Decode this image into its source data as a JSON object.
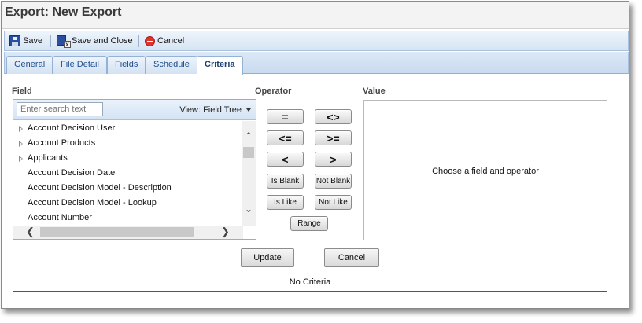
{
  "window": {
    "title": "Export: New Export"
  },
  "toolbar": {
    "save": "Save",
    "save_close": "Save and Close",
    "cancel": "Cancel"
  },
  "tabs": [
    "General",
    "File Detail",
    "Fields",
    "Schedule",
    "Criteria"
  ],
  "active_tab": "Criteria",
  "labels": {
    "field": "Field",
    "operator": "Operator",
    "value": "Value"
  },
  "search": {
    "placeholder": "Enter search text",
    "value": ""
  },
  "view_selector": {
    "label": "View: Field Tree"
  },
  "field_tree": [
    {
      "label": "Account Decision User",
      "expandable": true
    },
    {
      "label": "Account Products",
      "expandable": true
    },
    {
      "label": "Applicants",
      "expandable": true
    },
    {
      "label": "Account Decision Date",
      "expandable": false
    },
    {
      "label": "Account Decision Model - Description",
      "expandable": false
    },
    {
      "label": "Account Decision Model - Lookup",
      "expandable": false
    },
    {
      "label": "Account Number",
      "expandable": false
    }
  ],
  "operators": [
    "=",
    "<>",
    "<=",
    ">=",
    "<",
    ">",
    "Is Blank",
    "Not Blank",
    "Is Like",
    "Not Like",
    "Range"
  ],
  "value_panel": {
    "message": "Choose a field and operator"
  },
  "actions": {
    "update": "Update",
    "cancel": "Cancel"
  },
  "criteria_summary": "No Criteria",
  "colors": {
    "toolbar_blue": "#d6e4f3",
    "tab_text": "#1d4f91",
    "border_blue": "#8fb0d6"
  }
}
